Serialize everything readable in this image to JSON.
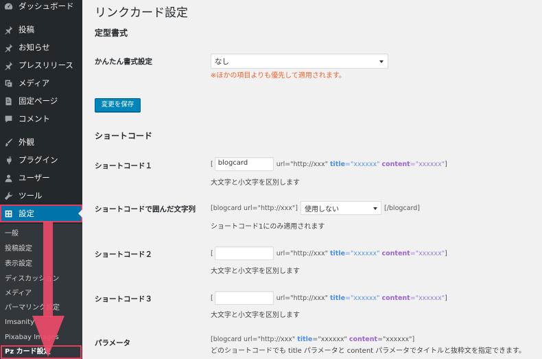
{
  "sidebar": {
    "items": [
      {
        "label": "ダッシュボード",
        "icon": "dashboard-icon"
      },
      {
        "label": "投稿",
        "icon": "pin-icon"
      },
      {
        "label": "お知らせ",
        "icon": "pin-icon"
      },
      {
        "label": "プレスリリース",
        "icon": "pin-icon"
      },
      {
        "label": "メディア",
        "icon": "media-icon"
      },
      {
        "label": "固定ページ",
        "icon": "page-icon"
      },
      {
        "label": "コメント",
        "icon": "comment-icon"
      },
      {
        "label": "外観",
        "icon": "brush-icon"
      },
      {
        "label": "プラグイン",
        "icon": "plugin-icon"
      },
      {
        "label": "ユーザー",
        "icon": "user-icon"
      },
      {
        "label": "ツール",
        "icon": "wrench-icon"
      },
      {
        "label": "設定",
        "icon": "settings-icon"
      }
    ],
    "submenu": [
      "一般",
      "投稿設定",
      "表示設定",
      "ディスカッション",
      "メディア",
      "パーマリンク設定",
      "Imsanity",
      "Pixabay Images",
      "Pz カード設定"
    ]
  },
  "page": {
    "title": "リンクカード設定",
    "section_format": "定型書式",
    "easy_format_label": "かんたん書式設定",
    "easy_format_value": "なし",
    "easy_format_warning": "※ほかの項目よりも優先して適用されます。",
    "save_label": "変更を保存",
    "section_shortcode": "ショートコード",
    "shortcode1_label": "ショートコード１",
    "shortcode1_value": "blogcard",
    "enclosed_label": "ショートコードで囲んだ文字列",
    "enclosed_open": "[blogcard url=\"http://xxx\"]",
    "enclosed_select": "使用しない",
    "enclosed_close": "[/blogcard]",
    "enclosed_note": "ショートコード1にのみ適用されます",
    "shortcode2_label": "ショートコード２",
    "shortcode2_value": "",
    "shortcode3_label": "ショートコード３",
    "shortcode3_value": "",
    "case_note": "大文字と小文字を区別します",
    "param_label": "パラメータ",
    "param_example_prefix": "[blogcard url=\"http://xxx\"",
    "param_note": "どのショートコードでも title パラメータと content パラメータでタイトルと抜粋文を指定できます。",
    "bracket_open": "[",
    "bracket_close": "]",
    "url_part": "url=\"http://xxx\"",
    "title_kw": "title",
    "title_val": "=\"xxxxxx\"",
    "content_kw": "content",
    "content_val": "=\"xxxxxx\""
  }
}
